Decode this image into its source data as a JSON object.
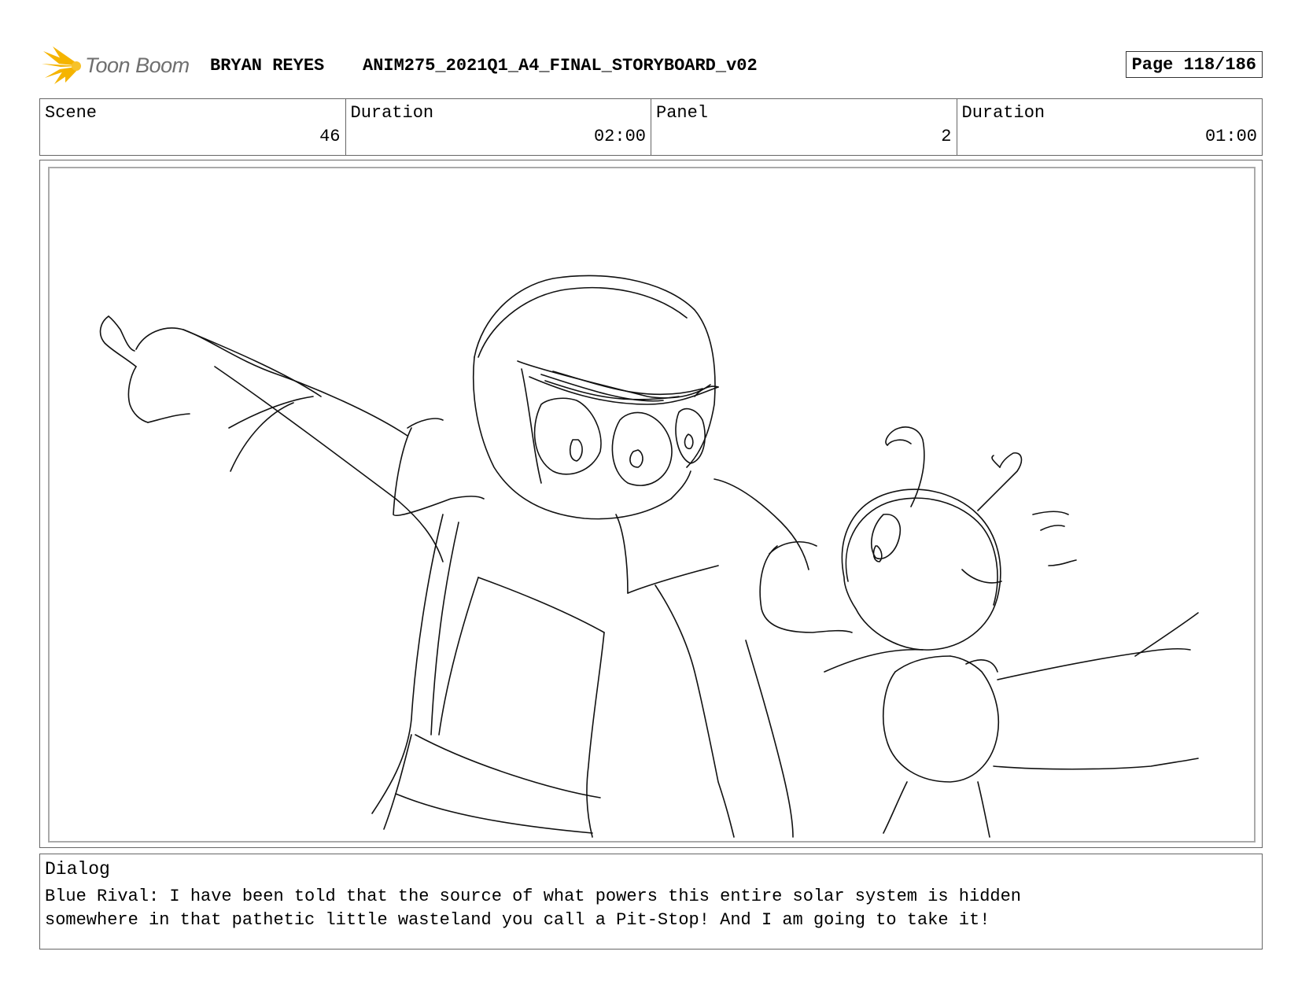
{
  "header": {
    "logo_text": "Toon Boom",
    "author": "BRYAN REYES",
    "project": "ANIM275_2021Q1_A4_FINAL_STORYBOARD_v02",
    "page": "Page 118/186"
  },
  "info": {
    "scene_label": "Scene",
    "scene_value": "46",
    "scene_duration_label": "Duration",
    "scene_duration_value": "02:00",
    "panel_label": "Panel",
    "panel_value": "2",
    "panel_duration_label": "Duration",
    "panel_duration_value": "01:00"
  },
  "dialog": {
    "label": "Dialog",
    "text": "Blue Rival: I have been told that the source of what powers this entire solar system is hidden\nsomewhere in that pathetic little wasteland you call a Pit-Stop! And I am going to take it!"
  },
  "colors": {
    "logo_accent": "#f5b400",
    "logo_text": "#6f6f6f"
  },
  "icons": {
    "logo": "toon-boom-starburst-icon"
  }
}
